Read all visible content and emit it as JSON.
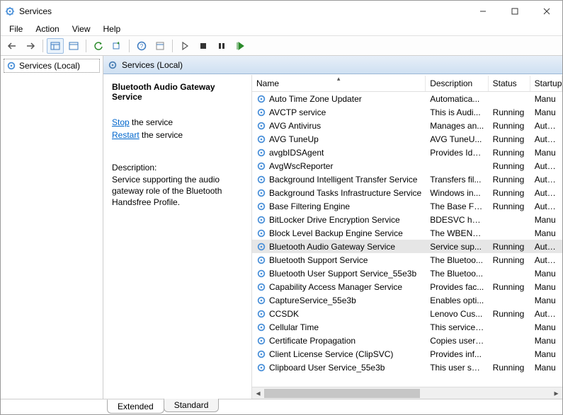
{
  "window": {
    "title": "Services"
  },
  "menu": {
    "file": "File",
    "action": "Action",
    "view": "View",
    "help": "Help"
  },
  "nav": {
    "root": "Services (Local)"
  },
  "header": {
    "title": "Services (Local)"
  },
  "detail": {
    "title": "Bluetooth Audio Gateway Service",
    "stop_link": "Stop",
    "stop_suffix": " the service",
    "restart_link": "Restart",
    "restart_suffix": " the service",
    "desc_label": "Description:",
    "desc_text": "Service supporting the audio gateway role of the Bluetooth Handsfree Profile."
  },
  "columns": {
    "name": "Name",
    "description": "Description",
    "status": "Status",
    "startup": "Startup"
  },
  "services": [
    {
      "name": "Auto Time Zone Updater",
      "desc": "Automatica...",
      "status": "",
      "start": "Manu"
    },
    {
      "name": "AVCTP service",
      "desc": "This is Audi...",
      "status": "Running",
      "start": "Manu"
    },
    {
      "name": "AVG Antivirus",
      "desc": "Manages an...",
      "status": "Running",
      "start": "Autom"
    },
    {
      "name": "AVG TuneUp",
      "desc": "AVG TuneU...",
      "status": "Running",
      "start": "Autom"
    },
    {
      "name": "avgbIDSAgent",
      "desc": "Provides Ide...",
      "status": "Running",
      "start": "Manu"
    },
    {
      "name": "AvgWscReporter",
      "desc": "",
      "status": "Running",
      "start": "Autom"
    },
    {
      "name": "Background Intelligent Transfer Service",
      "desc": "Transfers fil...",
      "status": "Running",
      "start": "Autom"
    },
    {
      "name": "Background Tasks Infrastructure Service",
      "desc": "Windows in...",
      "status": "Running",
      "start": "Autom"
    },
    {
      "name": "Base Filtering Engine",
      "desc": "The Base Fil...",
      "status": "Running",
      "start": "Autom"
    },
    {
      "name": "BitLocker Drive Encryption Service",
      "desc": "BDESVC hos...",
      "status": "",
      "start": "Manu"
    },
    {
      "name": "Block Level Backup Engine Service",
      "desc": "The WBENG...",
      "status": "",
      "start": "Manu"
    },
    {
      "name": "Bluetooth Audio Gateway Service",
      "desc": "Service sup...",
      "status": "Running",
      "start": "Autom",
      "selected": true
    },
    {
      "name": "Bluetooth Support Service",
      "desc": "The Bluetoo...",
      "status": "Running",
      "start": "Autom"
    },
    {
      "name": "Bluetooth User Support Service_55e3b",
      "desc": "The Bluetoo...",
      "status": "",
      "start": "Manu"
    },
    {
      "name": "Capability Access Manager Service",
      "desc": "Provides fac...",
      "status": "Running",
      "start": "Manu"
    },
    {
      "name": "CaptureService_55e3b",
      "desc": "Enables opti...",
      "status": "",
      "start": "Manu"
    },
    {
      "name": "CCSDK",
      "desc": "Lenovo Cus...",
      "status": "Running",
      "start": "Autom"
    },
    {
      "name": "Cellular Time",
      "desc": "This service ...",
      "status": "",
      "start": "Manu"
    },
    {
      "name": "Certificate Propagation",
      "desc": "Copies user ...",
      "status": "",
      "start": "Manu"
    },
    {
      "name": "Client License Service (ClipSVC)",
      "desc": "Provides inf...",
      "status": "",
      "start": "Manu"
    },
    {
      "name": "Clipboard User Service_55e3b",
      "desc": "This user ser...",
      "status": "Running",
      "start": "Manu"
    }
  ],
  "tabs": {
    "extended": "Extended",
    "standard": "Standard"
  }
}
